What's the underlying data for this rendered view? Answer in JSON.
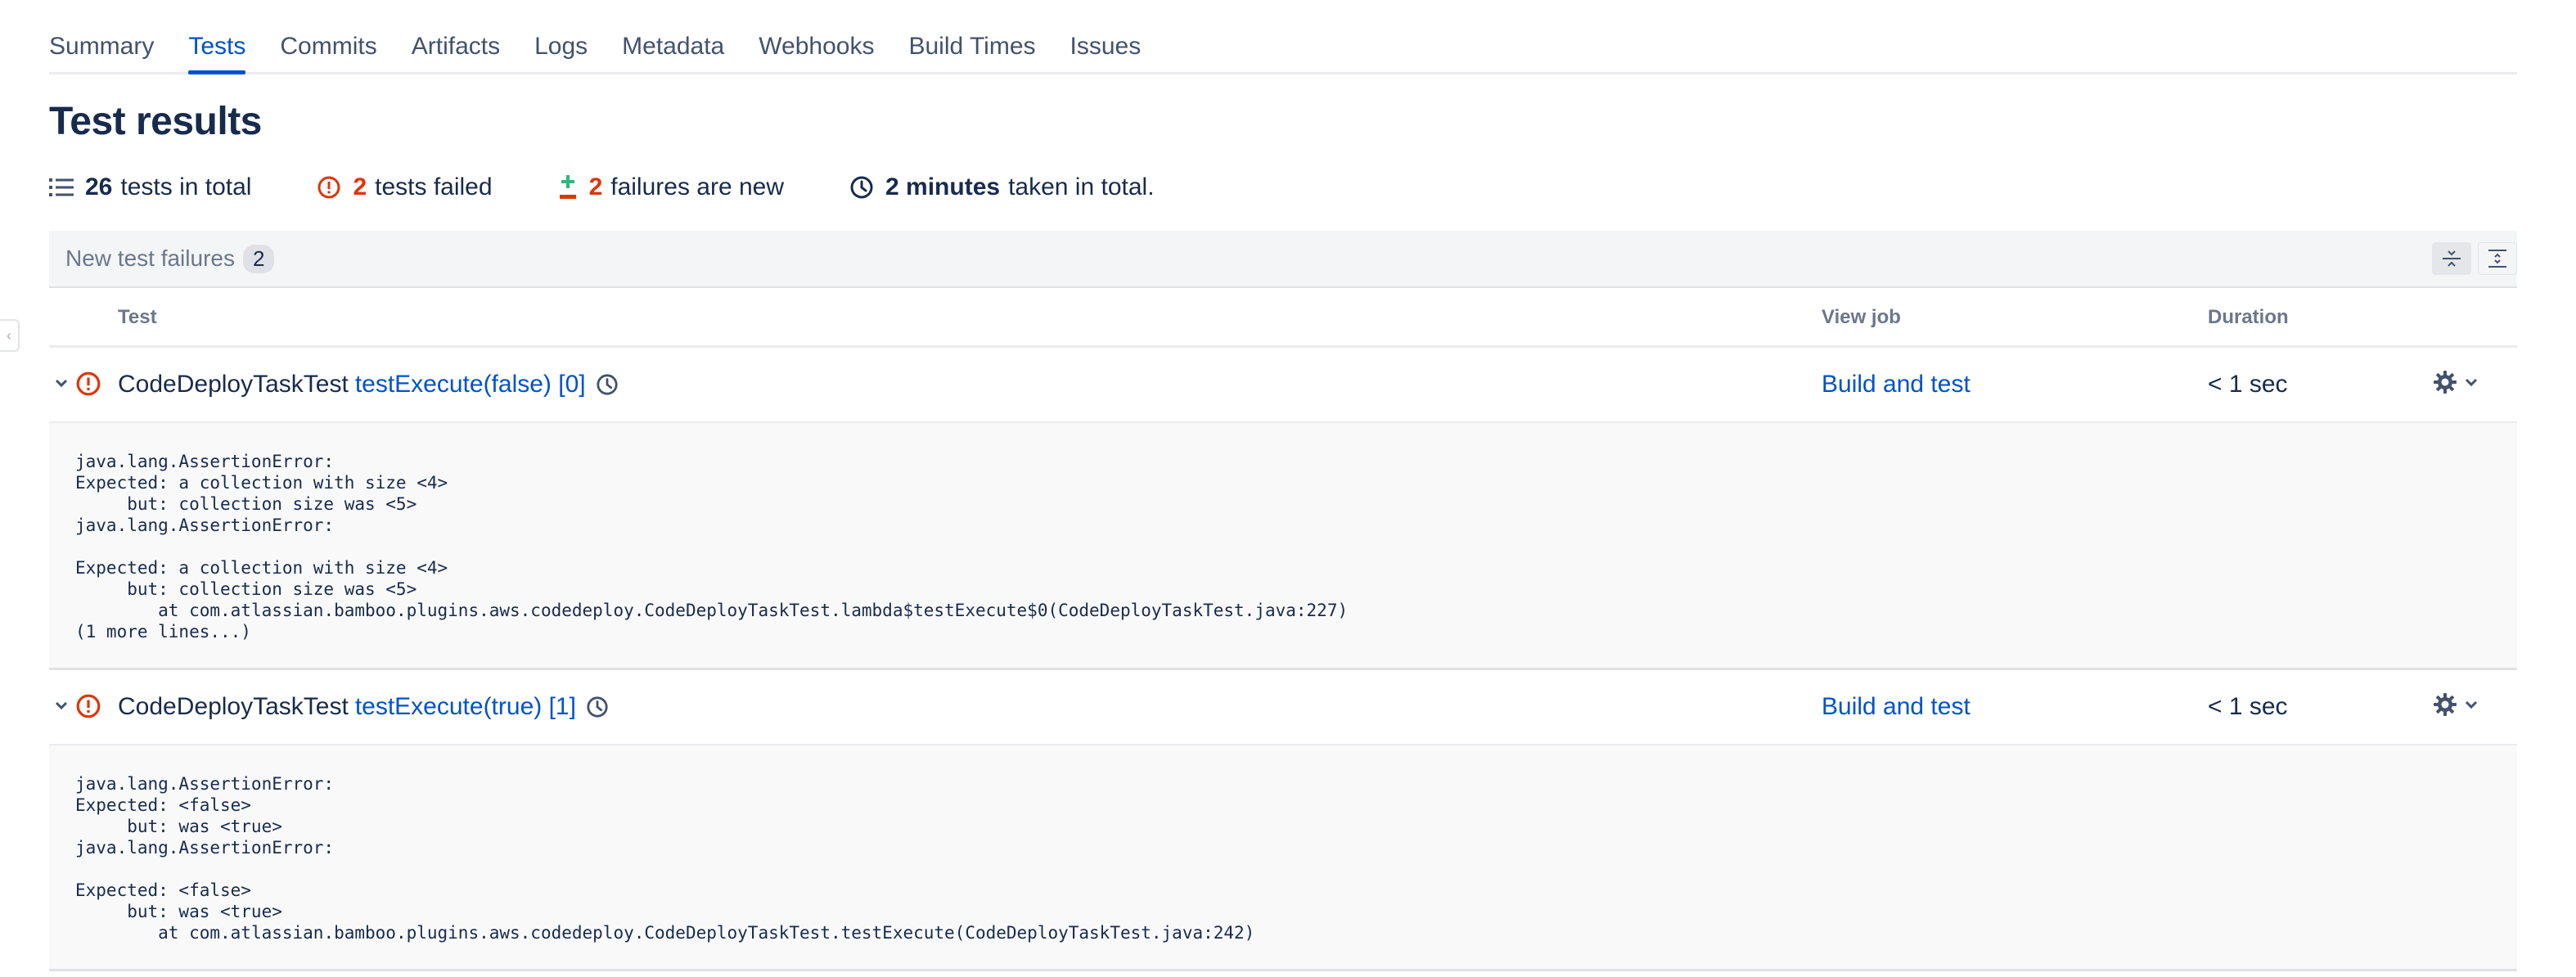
{
  "tabs": [
    "Summary",
    "Tests",
    "Commits",
    "Artifacts",
    "Logs",
    "Metadata",
    "Webhooks",
    "Build Times",
    "Issues"
  ],
  "active_tab": "Tests",
  "page_title": "Test results",
  "stats": {
    "total": {
      "num": "26",
      "label": "tests in total"
    },
    "failed": {
      "num": "2",
      "label": "tests failed"
    },
    "new_failures": {
      "num": "2",
      "label": "failures are new"
    },
    "time": {
      "num": "2 minutes",
      "label": "taken in total."
    }
  },
  "panel": {
    "title": "New test failures",
    "count": "2",
    "columns": {
      "test": "Test",
      "view_job": "View job",
      "duration": "Duration"
    }
  },
  "rows": [
    {
      "class_name": "CodeDeployTaskTest",
      "method": "testExecute(false) [0]",
      "job": "Build and test",
      "duration": "< 1 sec",
      "trace": "java.lang.AssertionError: \nExpected: a collection with size <4>\n     but: collection size was <5>\njava.lang.AssertionError: \n\nExpected: a collection with size <4>\n     but: collection size was <5>\n\tat com.atlassian.bamboo.plugins.aws.codedeploy.CodeDeployTaskTest.lambda$testExecute$0(CodeDeployTaskTest.java:227)\n(1 more lines...)"
    },
    {
      "class_name": "CodeDeployTaskTest",
      "method": "testExecute(true) [1]",
      "job": "Build and test",
      "duration": "< 1 sec",
      "trace": "java.lang.AssertionError: \nExpected: <false>\n     but: was <true>\njava.lang.AssertionError: \n\nExpected: <false>\n     but: was <true>\n\tat com.atlassian.bamboo.plugins.aws.codedeploy.CodeDeployTaskTest.testExecute(CodeDeployTaskTest.java:242)"
    }
  ],
  "colors": {
    "link": "#0052cc",
    "error": "#de350b",
    "success": "#36b37e",
    "text": "#172b4d"
  }
}
